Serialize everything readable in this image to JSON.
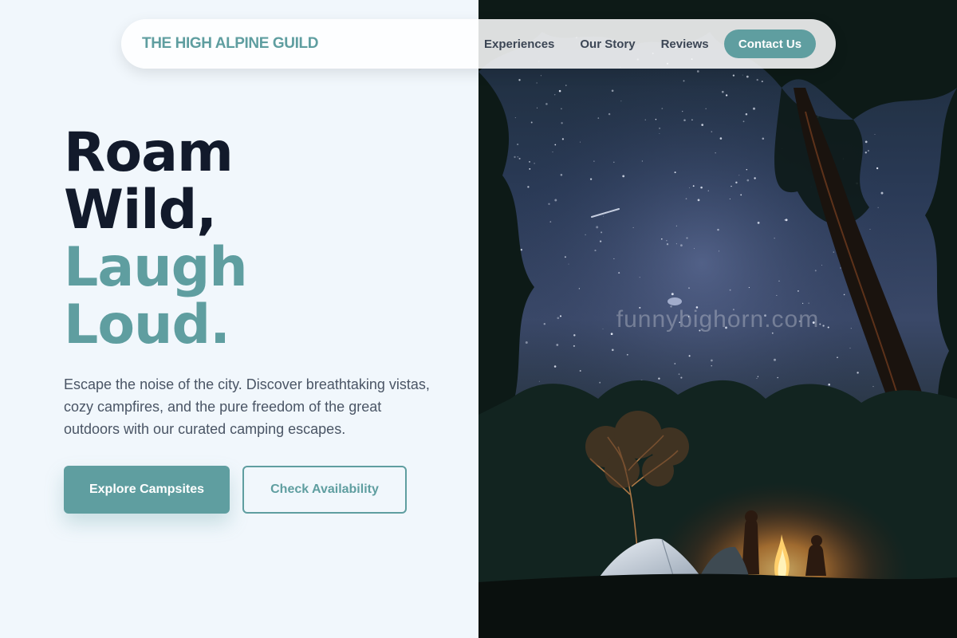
{
  "nav": {
    "logo": "THE HIGH ALPINE GUILD",
    "links": [
      "Experiences",
      "Our Story",
      "Reviews"
    ],
    "cta": "Contact Us"
  },
  "hero": {
    "title_lines": [
      "Roam",
      "Wild,",
      "Laugh",
      "Loud."
    ],
    "description": "Escape the noise of the city. Discover breathtaking vistas, cozy campfires, and the pure freedom of the great outdoors with our curated camping escapes.",
    "primary_button": "Explore Campsites",
    "secondary_button": "Check Availability"
  },
  "image": {
    "watermark": "funnybighorn.com"
  },
  "colors": {
    "accent": "#5f9ea0",
    "heading_dark": "#121a2b",
    "background": "#f1f7fc"
  }
}
